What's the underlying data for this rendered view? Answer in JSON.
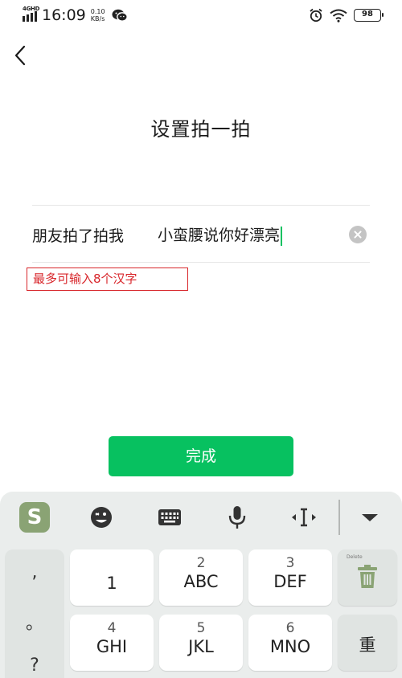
{
  "status_bar": {
    "network": "4GHD",
    "time": "16:09",
    "speed_value": "0.10",
    "speed_unit": "KB/s",
    "battery": "98",
    "icons": [
      "signal-icon",
      "wechat-icon",
      "alarm-icon",
      "wifi-icon",
      "battery-icon"
    ]
  },
  "header": {
    "back_icon": "chevron-left-icon",
    "title": "设置拍一拍"
  },
  "input": {
    "prefix": "朋友拍了拍我",
    "value": "小蛮腰说你好漂亮",
    "clear_icon": "clear-circle-icon",
    "hint": "最多可输入8个汉字"
  },
  "done_button": {
    "label": "完成"
  },
  "keyboard": {
    "logo_text": "S",
    "toolbar_icons": [
      "sogou-logo-icon",
      "emoji-icon",
      "keyboard-icon",
      "microphone-icon",
      "cursor-move-icon",
      "collapse-down-icon"
    ],
    "punctuation": [
      ",",
      "。",
      "?"
    ],
    "keys_row1": [
      {
        "num": "",
        "letters": "1"
      },
      {
        "num": "2",
        "letters": "ABC"
      },
      {
        "num": "3",
        "letters": "DEF"
      }
    ],
    "keys_row2": [
      {
        "num": "4",
        "letters": "GHI"
      },
      {
        "num": "5",
        "letters": "JKL"
      },
      {
        "num": "6",
        "letters": "MNO"
      }
    ],
    "delete_label": "Delete",
    "delete_icon": "trash-icon",
    "reset_label": "重"
  },
  "colors": {
    "accent_green": "#07c160",
    "hint_red": "#d8262b",
    "keyboard_bg": "#eaedec",
    "logo_green": "#8aa374"
  }
}
